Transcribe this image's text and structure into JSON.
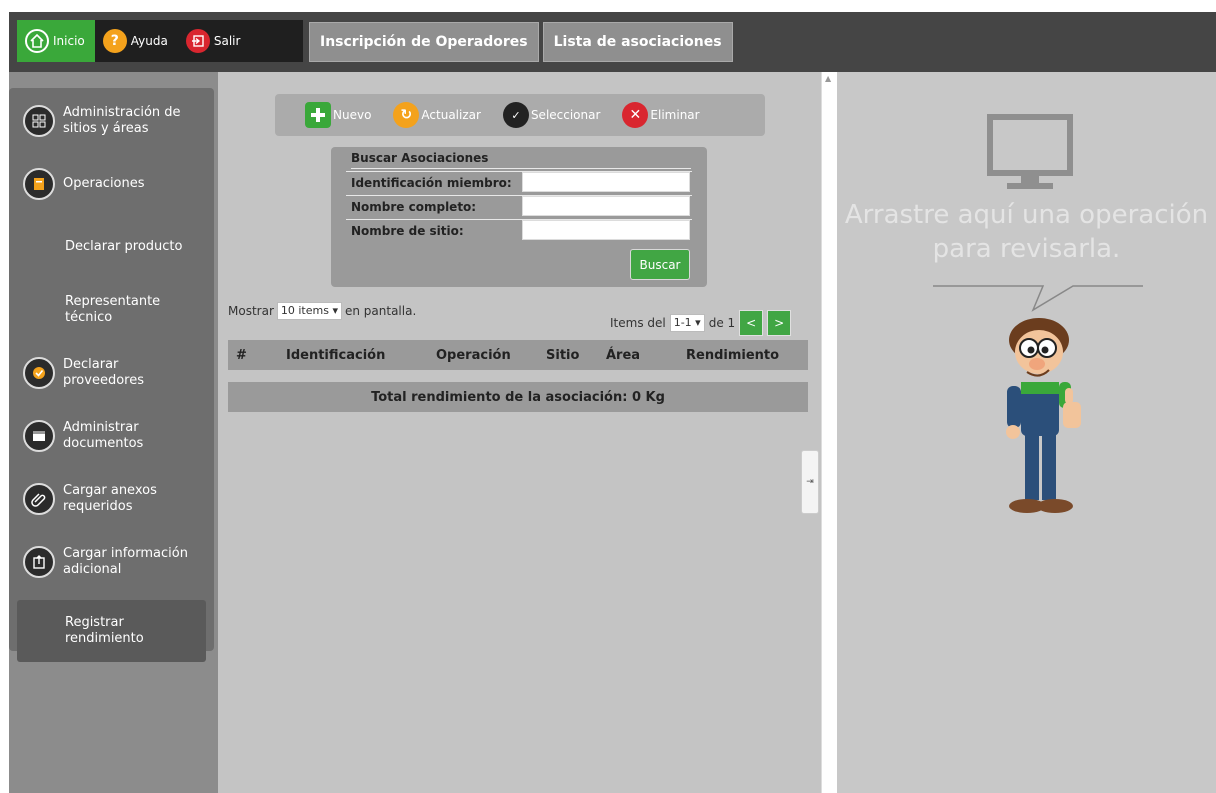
{
  "topnav": {
    "items": [
      {
        "label": "Inicio",
        "icon": "home-icon",
        "color": "#3aa83a"
      },
      {
        "label": "Ayuda",
        "icon": "help-icon",
        "color": "#f4a21c"
      },
      {
        "label": "Salir",
        "icon": "exit-icon",
        "color": "#d9262f"
      }
    ]
  },
  "tabs": [
    {
      "label": "Inscripción de Operadores"
    },
    {
      "label": "Lista de asociaciones"
    }
  ],
  "sidebar": {
    "items": [
      {
        "label": "Administración de sitios y áreas",
        "icon": "sites-icon"
      },
      {
        "label": "Operaciones",
        "icon": "operations-icon"
      },
      {
        "label": "Declarar producto"
      },
      {
        "label": "Representante técnico"
      },
      {
        "label": "Declarar proveedores",
        "icon": "suppliers-icon"
      },
      {
        "label": "Administrar documentos",
        "icon": "documents-icon"
      },
      {
        "label": "Cargar anexos requeridos",
        "icon": "attachment-icon"
      },
      {
        "label": "Cargar información adicional",
        "icon": "upload-icon"
      },
      {
        "label": "Registrar rendimiento"
      }
    ]
  },
  "toolbar": {
    "nuevo": "Nuevo",
    "actualizar": "Actualizar",
    "seleccionar": "Seleccionar",
    "eliminar": "Eliminar"
  },
  "search": {
    "title": "Buscar Asociaciones",
    "fields": [
      {
        "label": "Identificación miembro:",
        "value": ""
      },
      {
        "label": "Nombre completo:",
        "value": ""
      },
      {
        "label": "Nombre de sitio:",
        "value": ""
      }
    ],
    "button": "Buscar"
  },
  "paging": {
    "show_prefix": "Mostrar",
    "per_page": "10 items",
    "show_suffix": "en pantalla.",
    "items_prefix": "Items del",
    "range": "1-1",
    "of_label": "de 1",
    "prev": "<",
    "next": ">"
  },
  "table": {
    "columns": [
      "#",
      "Identificación",
      "Operación",
      "Sitio",
      "Área",
      "Rendimiento"
    ],
    "total": "Total rendimiento de la asociación: 0 Kg"
  },
  "right_panel": {
    "line1": "Arrastre aquí una operación",
    "line2": "para revisarla."
  },
  "colors": {
    "accent_green": "#41a644",
    "topbar": "#454545",
    "sidebar": "#6e6e6e"
  }
}
